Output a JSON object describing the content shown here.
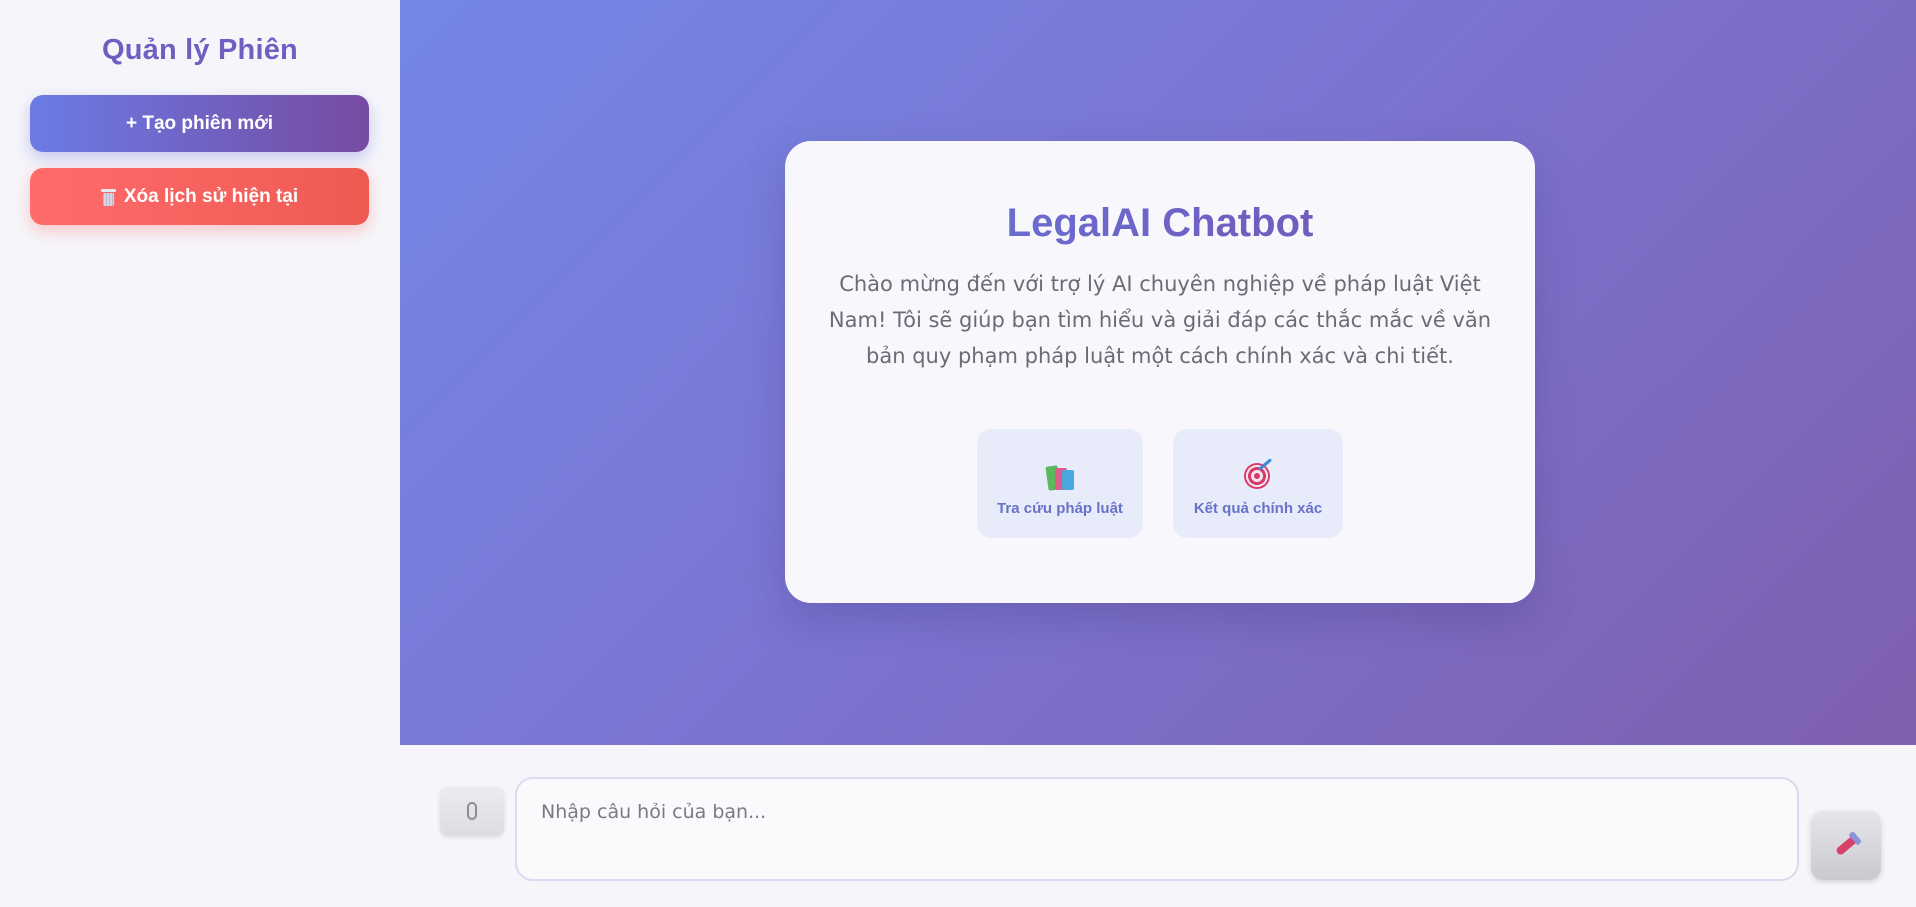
{
  "sidebar": {
    "title": "Quản lý Phiên",
    "new_session_label": "+ Tạo phiên mới",
    "clear_history_label": "Xóa lịch sử hiện tại",
    "clear_history_icon": "trash-icon"
  },
  "welcome": {
    "title": "LegalAI Chatbot",
    "text": "Chào mừng đến với trợ lý AI chuyên nghiệp về pháp luật Việt Nam! Tôi sẽ giúp bạn tìm hiểu và giải đáp các thắc mắc về văn bản quy phạm pháp luật một cách chính xác và chi tiết.",
    "features": [
      {
        "icon": "books-icon",
        "label": "Tra cứu pháp luật"
      },
      {
        "icon": "target-icon",
        "label": "Kết quả chính xác"
      }
    ]
  },
  "composer": {
    "attach_icon": "paperclip-icon",
    "placeholder": "Nhập câu hỏi của bạn...",
    "send_icon": "rocket-icon"
  },
  "colors": {
    "accent_start": "#667eea",
    "accent_end": "#764ba2",
    "danger": "#ff6b6b"
  }
}
